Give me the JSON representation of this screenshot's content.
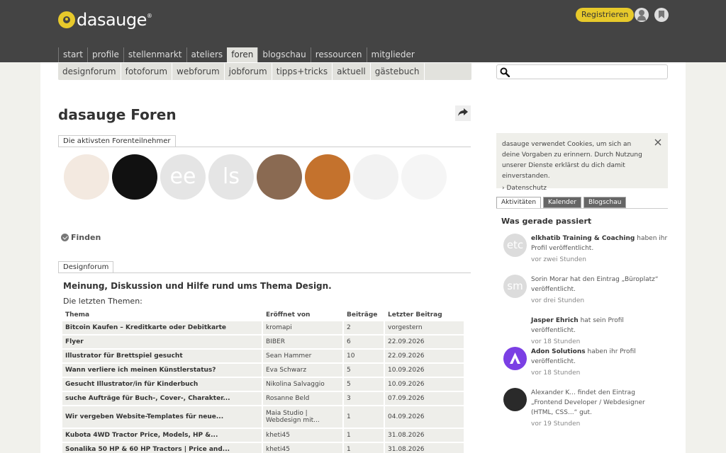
{
  "header": {
    "logo_text": "dasauge",
    "logo_mark": "®",
    "register_label": "Registrieren"
  },
  "main_nav": [
    "start",
    "profile",
    "stellenmarkt",
    "ateliers",
    "foren",
    "blogschau",
    "ressourcen",
    "mitglieder"
  ],
  "main_nav_active": "foren",
  "sub_nav": [
    "designforum",
    "fotoforum",
    "webforum",
    "jobforum",
    "tipps+tricks",
    "aktuell",
    "gästebuch"
  ],
  "search": {
    "placeholder": ""
  },
  "page_title": "dasauge Foren",
  "active_tab_label": "Die aktivsten Forenteilnehmer",
  "avatars": [
    {
      "initials": "",
      "color": "#f3e9e0"
    },
    {
      "initials": "",
      "color": "#111111"
    },
    {
      "initials": "ee",
      "color": "#e5e5e5"
    },
    {
      "initials": "ls",
      "color": "#e5e5e5"
    },
    {
      "initials": "",
      "color": "#8a6a52"
    },
    {
      "initials": "",
      "color": "#c4722d"
    },
    {
      "initials": "",
      "color": "#f2f2f2"
    },
    {
      "initials": "",
      "color": "#f5f5f5"
    }
  ],
  "finden_label": "Finden",
  "forum_tab_label": "Designforum",
  "forum_description": "Meinung, Diskussion und Hilfe rund ums Thema Design.",
  "latest_label": "Die letzten Themen:",
  "table": {
    "headers": [
      "Thema",
      "Eröffnet von",
      "Beiträge",
      "Letzter Beitrag"
    ],
    "rows": [
      [
        "Bitcoin Kaufen – Kreditkarte oder Debitkarte",
        "kromapi",
        "2",
        "vorgestern"
      ],
      [
        "Flyer",
        "BIBER",
        "6",
        "22.09.2026"
      ],
      [
        "Illustrator für Brettspiel gesucht",
        "Sean Hammer",
        "10",
        "22.09.2026"
      ],
      [
        "Wann verliere ich meinen Künstlerstatus?",
        "Eva Schwarz",
        "5",
        "10.09.2026"
      ],
      [
        "Gesucht Illustrator/in für Kinderbuch",
        "Nikolina Salvaggio",
        "5",
        "10.09.2026"
      ],
      [
        "suche Aufträge für Buch-, Cover-, Charakter...",
        "Rosanne Beld",
        "3",
        "07.09.2026"
      ],
      [
        "Wir vergeben Website-Templates für neue...",
        "Maia Studio | Webdesign mit...",
        "1",
        "04.09.2026"
      ],
      [
        "Kubota 4WD Tractor Price, Models, HP &...",
        "kheti45",
        "1",
        "31.08.2026"
      ],
      [
        "Sonalika 50 HP & 60 HP Tractors | Price and...",
        "kheti45",
        "1",
        "31.08.2026"
      ]
    ]
  },
  "cookie": {
    "text": "dasauge verwendet Cookies, um sich an deine Vorgaben zu erinnern. Durch Nutzung unserer Dienste erklärst du dich damit einverstanden.",
    "link": "› Datenschutz"
  },
  "right_tabs": [
    "Aktivitäten",
    "Kalender",
    "Blogschau"
  ],
  "activity_title": "Was gerade passiert",
  "activities": [
    {
      "initials": "etc",
      "color": "#dcdcdc",
      "name": "elkhatib Training & Coaching",
      "text": " haben ihr Profil veröffentlicht.",
      "time": "vor zwei Stunden"
    },
    {
      "initials": "sm",
      "color": "#dcdcdc",
      "name": "",
      "text": "Sorin Morar hat den Eintrag „Büroplatz“ veröffentlicht.",
      "time": "vor drei Stunden"
    },
    {
      "initials": "",
      "color": "#ffffff",
      "name": "Jasper Ehrich",
      "text": " hat sein Profil veröffentlicht.",
      "time": "vor 18 Stunden"
    },
    {
      "initials": "",
      "color": "#7b3fe4",
      "name": "Adon Solutions",
      "text": " haben ihr Profil veröffentlicht.",
      "time": "vor 18 Stunden"
    },
    {
      "initials": "",
      "color": "#2a2a2a",
      "name": "",
      "text": "Alexander K... findet den Eintrag „Frontend Developer / Webdesigner (HTML, CSS...“ gut.",
      "time": "vor 19 Stunden"
    }
  ]
}
